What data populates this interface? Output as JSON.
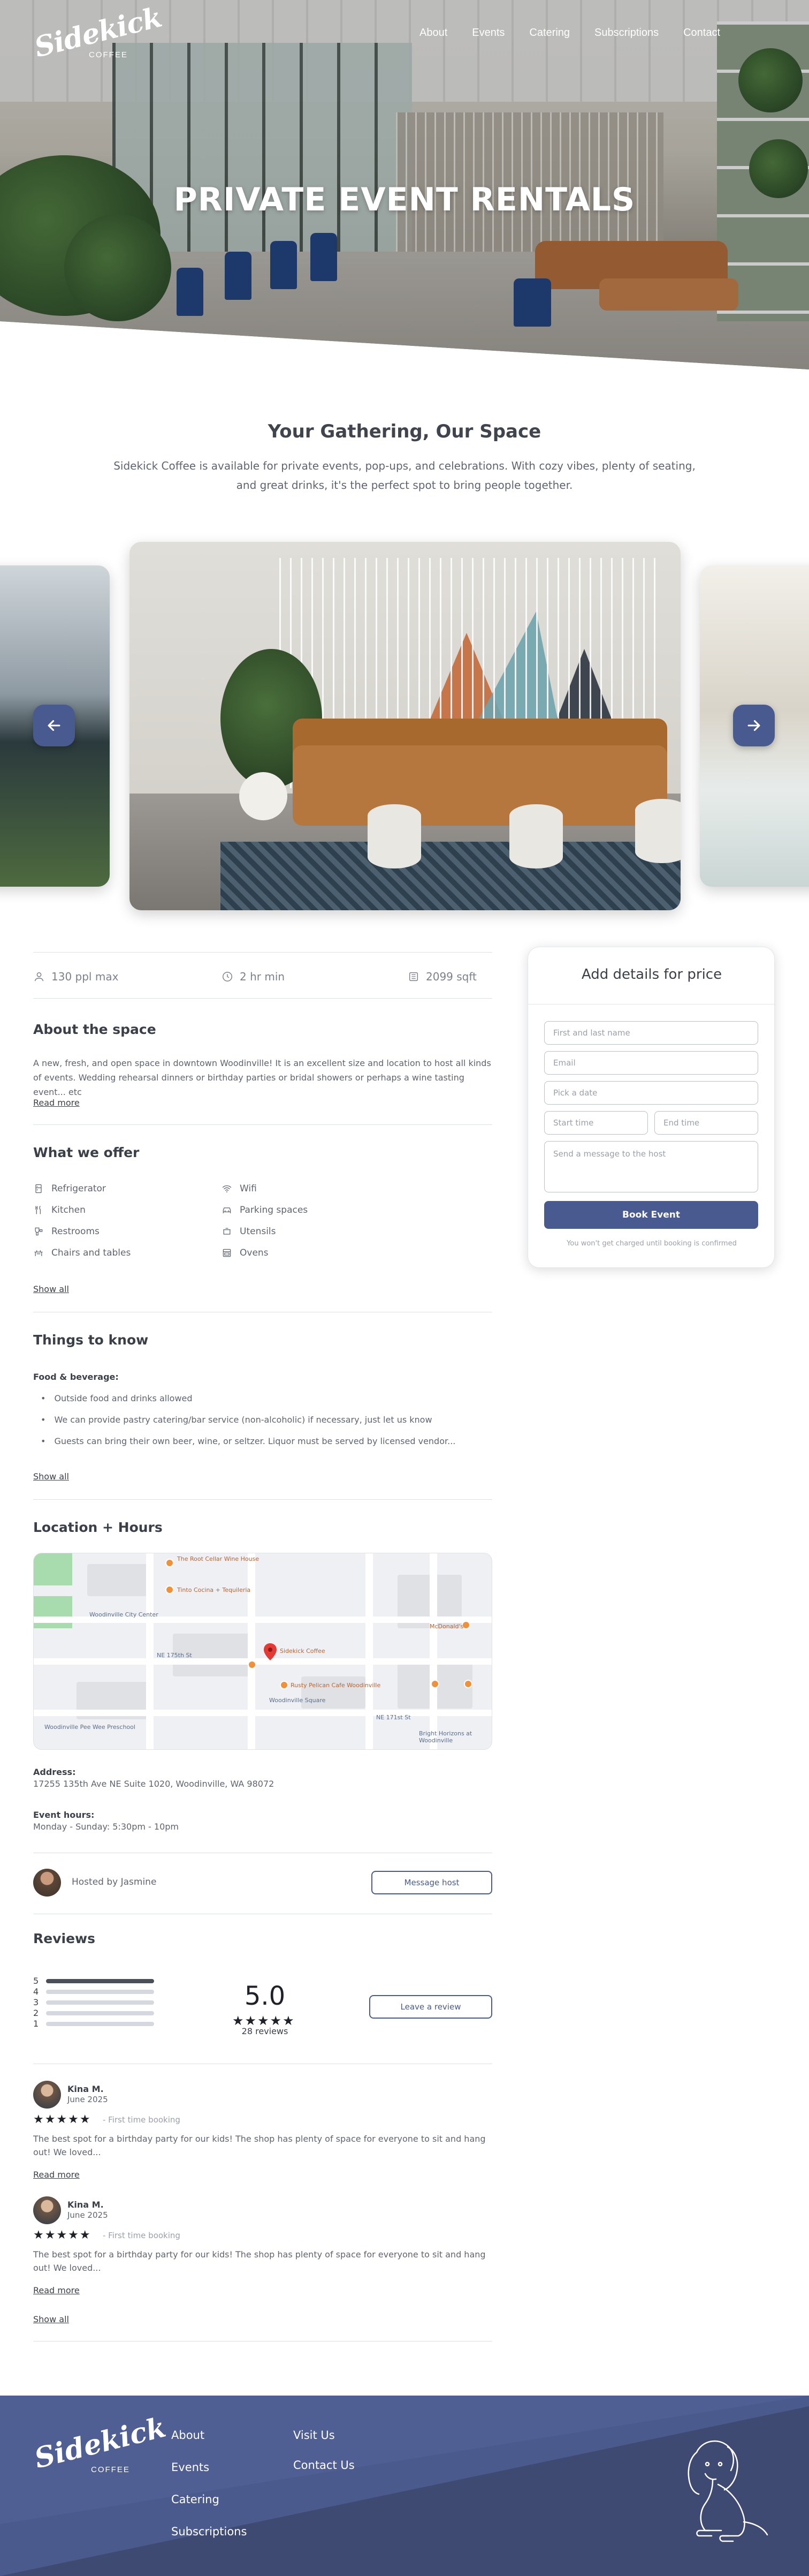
{
  "brand": {
    "script": "Sidekick",
    "sub": "COFFEE"
  },
  "nav": [
    "About",
    "Events",
    "Catering",
    "Subscriptions",
    "Contact"
  ],
  "hero": {
    "title": "PRIVATE EVENT RENTALS"
  },
  "intro": {
    "title": "Your Gathering, Our Space",
    "text": "Sidekick Coffee is available for private events, pop-ups, and celebrations. With cozy vibes, plenty of seating, and great drinks, it's the perfect spot to bring people together."
  },
  "stats": {
    "capacity": "130 ppl max",
    "duration": "2 hr min",
    "size": "2099 sqft"
  },
  "about": {
    "title": "About the space",
    "text": "A new, fresh, and open space in downtown Woodinville! It is an excellent size and location to host all kinds of events. Wedding rehearsal dinners or birthday parties or bridal showers or perhaps a wine tasting event... etc",
    "read_more": "Read more"
  },
  "offer": {
    "title": "What we offer",
    "items": [
      {
        "label": "Refrigerator",
        "icon": "fridge-icon"
      },
      {
        "label": "Wifi",
        "icon": "wifi-icon"
      },
      {
        "label": "Kitchen",
        "icon": "kitchen-icon"
      },
      {
        "label": "Parking spaces",
        "icon": "car-icon"
      },
      {
        "label": "Restrooms",
        "icon": "restroom-icon"
      },
      {
        "label": "Utensils",
        "icon": "utensils-icon"
      },
      {
        "label": "Chairs and tables",
        "icon": "chairs-icon"
      },
      {
        "label": "Ovens",
        "icon": "oven-icon"
      }
    ],
    "show_all": "Show all"
  },
  "know": {
    "title": "Things to know",
    "label": "Food & beverage:",
    "items": [
      "Outside food and drinks allowed",
      "We can provide pastry catering/bar service (non-alcoholic) if necessary, just let us know",
      "Guests can bring their own beer, wine, or seltzer. Liquor must be served by licensed vendor..."
    ],
    "show_all": "Show all"
  },
  "location": {
    "title": "Location + Hours",
    "map_labels": [
      "The Root Cellar Wine House",
      "Tinto Cocina + Tequileria",
      "Woodinville City Center",
      "Sidekick Coffee",
      "McDonald's",
      "Rusty Pelican Cafe Woodinville",
      "Woodinville Square",
      "Bright Horizons at Woodinville",
      "Woodinville Pee Wee Preschool",
      "NE 175th St",
      "NE 171st St"
    ],
    "address_label": "Address:",
    "address": "17255 135th Ave NE Suite 1020, Woodinville, WA 98072",
    "hours_label": "Event hours:",
    "hours": "Monday - Sunday: 5:30pm - 10pm"
  },
  "host": {
    "text": "Hosted by Jasmine",
    "button": "Message host"
  },
  "reviews": {
    "title": "Reviews",
    "distribution": [
      {
        "star": "5",
        "fraction": 1.0
      },
      {
        "star": "4",
        "fraction": 0.0
      },
      {
        "star": "3",
        "fraction": 0.0
      },
      {
        "star": "2",
        "fraction": 0.0
      },
      {
        "star": "1",
        "fraction": 0.0
      }
    ],
    "score": "5.0",
    "stars": "★★★★★",
    "count": "28 reviews",
    "leave_button": "Leave a review",
    "items": [
      {
        "name": "Kina M.",
        "date": "June 2025",
        "stars": "★★★★★",
        "tag": "- First time booking",
        "text": "The best spot for a birthday party for our kids! The shop has plenty of space for everyone to sit and hang out! We loved...",
        "read_more": "Read more"
      },
      {
        "name": "Kina M.",
        "date": "June 2025",
        "stars": "★★★★★",
        "tag": "- First time booking",
        "text": "The best spot for a birthday party for our kids! The shop has plenty of space for everyone to sit and hang out! We loved...",
        "read_more": "Read more"
      }
    ],
    "show_all": "Show all"
  },
  "booking": {
    "title": "Add details for price",
    "name_placeholder": "First and last name",
    "email_placeholder": "Email",
    "date_placeholder": "Pick a date",
    "start_placeholder": "Start time",
    "end_placeholder": "End time",
    "message_placeholder": "Send a message to the host",
    "button": "Book Event",
    "note": "You won't get charged until booking is confirmed"
  },
  "footer": {
    "col1": [
      "About",
      "Events",
      "Catering",
      "Subscriptions"
    ],
    "col2": [
      "Visit Us",
      "Contact Us"
    ]
  },
  "colors": {
    "accent": "#485a8f",
    "footer": "#3e4a72",
    "text": "#5e6470",
    "heading": "#3a3f48"
  }
}
